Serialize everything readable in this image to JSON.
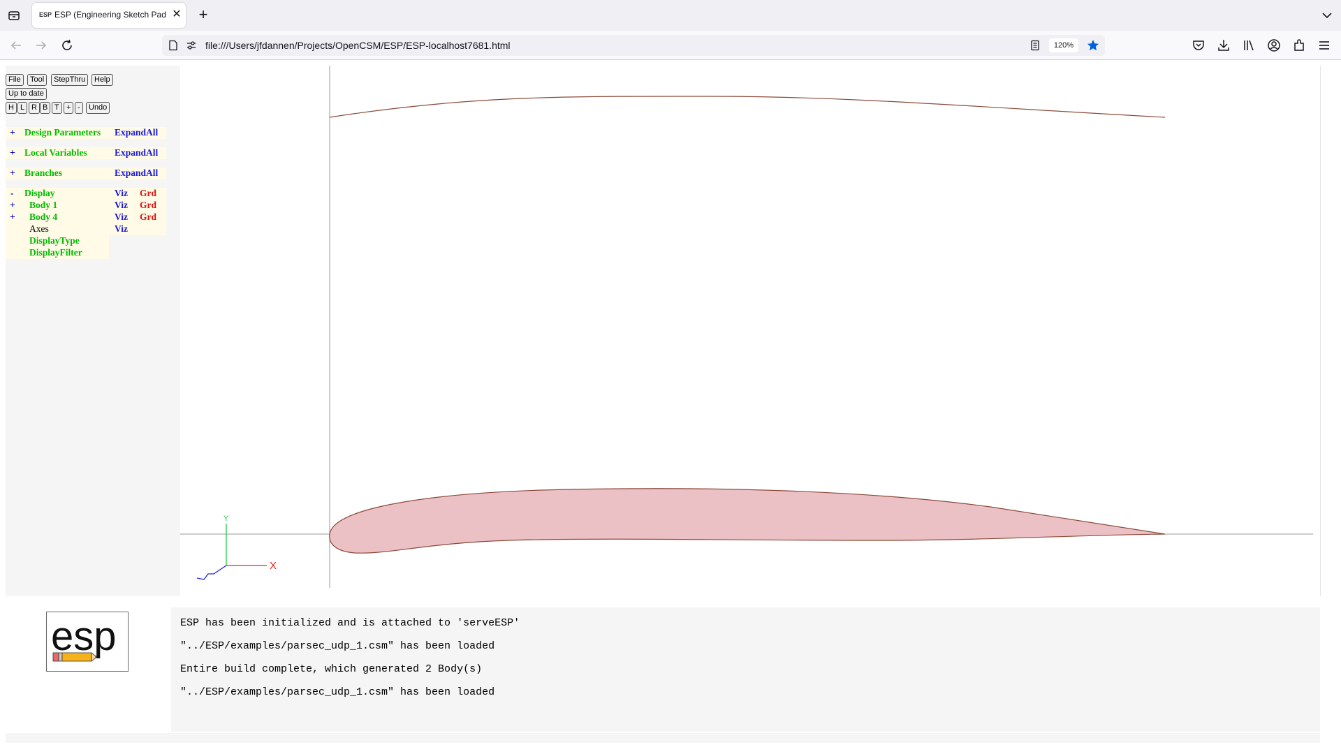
{
  "browser": {
    "tab_title": "ESP (Engineering Sketch Pad, V",
    "tab_favicon": "ESP",
    "url": "file:///Users/jfdannen/Projects/OpenCSM/ESP/ESP-localhost7681.html",
    "zoom": "120%",
    "new_tab": "+",
    "close_tab": "✕",
    "icons": [
      "tab-list-icon",
      "back-icon",
      "forward-icon",
      "reload-icon",
      "page-icon",
      "permissions-icon",
      "reader-view-icon",
      "bookmark-star-icon",
      "pocket-icon",
      "downloads-icon",
      "library-icon",
      "account-icon",
      "extensions-icon",
      "menu-icon",
      "tab-overflow-icon"
    ]
  },
  "toolbar": {
    "row1": [
      "File",
      "Tool",
      "StepThru",
      "Help"
    ],
    "row2": [
      "Up to date"
    ],
    "row3": [
      "H",
      "L",
      "R",
      "B",
      "T",
      "+",
      "-",
      "Undo"
    ]
  },
  "tree": {
    "design_parameters": {
      "toggle": "+",
      "label": "Design Parameters",
      "action": "ExpandAll"
    },
    "local_variables": {
      "toggle": "+",
      "label": "Local Variables",
      "action": "ExpandAll"
    },
    "branches": {
      "toggle": "+",
      "label": "Branches",
      "action": "ExpandAll"
    },
    "display": {
      "toggle": "-",
      "label": "Display",
      "viz": "Viz",
      "grd": "Grd"
    },
    "body1": {
      "toggle": "+",
      "label": "Body 1",
      "viz": "Viz",
      "grd": "Grd"
    },
    "body4": {
      "toggle": "+",
      "label": "Body 4",
      "viz": "Viz",
      "grd": "Grd"
    },
    "axes": {
      "label": "Axes",
      "viz": "Viz"
    },
    "display_type": {
      "label": "DisplayType"
    },
    "display_filter": {
      "label": "DisplayFilter"
    }
  },
  "axes_triad": {
    "y_label": "Y",
    "x_label": "X"
  },
  "colors": {
    "tree_green": "#00bb00",
    "tree_blue": "#1a1adb",
    "tree_red": "#dd1111",
    "airfoil_fill": "#ecc1c6",
    "airfoil_edge": "#8b4a3a",
    "bookmark_blue": "#0060df"
  },
  "logo": {
    "text": "esp"
  },
  "messages": [
    "ESP has been initialized and is attached to 'serveESP'",
    "\"../ESP/examples/parsec_udp_1.csm\" has been loaded",
    "Entire build complete, which generated 2 Body(s)",
    "\"../ESP/examples/parsec_udp_1.csm\" has been loaded"
  ]
}
